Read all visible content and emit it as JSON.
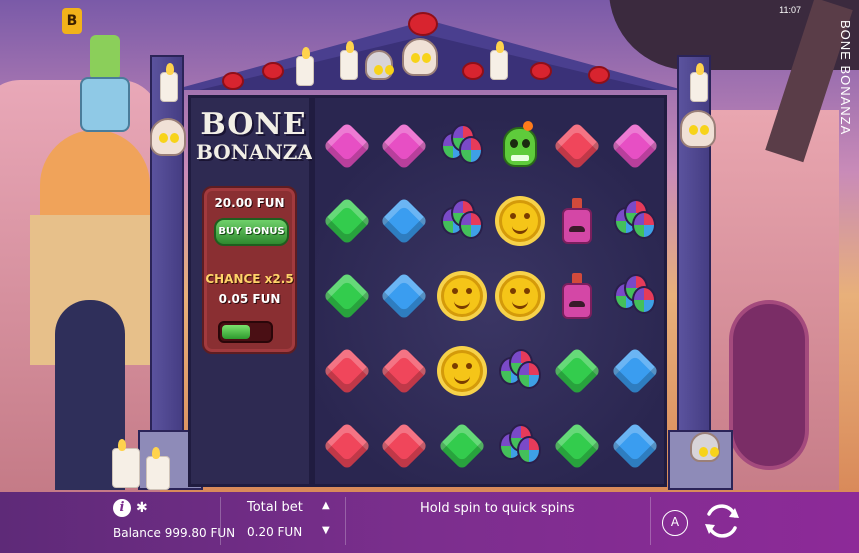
{
  "app": {
    "brand_letter": "B",
    "clock": "11:07",
    "vertical_title": "BONE BONANZA"
  },
  "game_title": {
    "line1": "BONE",
    "line2": "BONANZA"
  },
  "bonus_panel": {
    "buy_price": "20.00 FUN",
    "buy_button": "BUY BONUS",
    "chance_label": "CHANCE x2.5",
    "chance_price": "0.05 FUN",
    "chance_toggle_on": false
  },
  "reels": {
    "rows": [
      [
        "pink-gem",
        "pink-gem",
        "maracas",
        "green-skull",
        "red-gem",
        "pink-gem"
      ],
      [
        "green-gem",
        "blue-gem",
        "maracas",
        "sun",
        "bottle",
        "maracas"
      ],
      [
        "green-gem",
        "blue-gem",
        "sun",
        "sun",
        "bottle",
        "maracas"
      ],
      [
        "red-gem",
        "red-gem",
        "sun",
        "maracas",
        "green-gem",
        "blue-gem"
      ],
      [
        "red-gem",
        "red-gem",
        "green-gem",
        "maracas",
        "green-gem",
        "blue-gem"
      ]
    ]
  },
  "bottom_bar": {
    "balance_label": "Balance",
    "balance_value": "999.80 FUN",
    "total_bet_label": "Total bet",
    "total_bet_value": "0.20 FUN",
    "bet_up_symbol": "▲",
    "bet_down_symbol": "▼",
    "hold_message": "Hold spin to quick spins",
    "auto_label": "A"
  },
  "colors": {
    "bar_start": "#5e2a78",
    "bar_end": "#8d2a98",
    "bonus_panel": "#8a2f32",
    "buy_button": "#2f8a2f",
    "temple": "#4a3f8f"
  }
}
